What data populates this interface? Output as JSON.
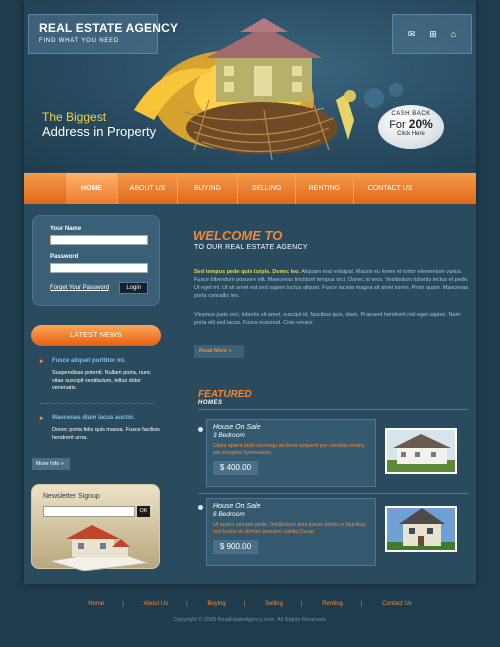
{
  "header": {
    "title": "REAL ESTATE AGENCY",
    "tagline": "FIND WHAT YOU NEED",
    "slogan_line1": "The Biggest",
    "slogan_line2": "Address in Property",
    "cashback": {
      "line1": "CASH BACK",
      "for_label": "For",
      "percent": "20%",
      "cta": "Click Here"
    },
    "icons": [
      "mail-icon",
      "sitemap-icon",
      "home-icon"
    ]
  },
  "nav": {
    "items": [
      {
        "label": "HOME",
        "active": true
      },
      {
        "label": "ABOUT US",
        "active": false
      },
      {
        "label": "BUYING",
        "active": false
      },
      {
        "label": "SELLING",
        "active": false
      },
      {
        "label": "RENTING",
        "active": false
      },
      {
        "label": "CONTACT US",
        "active": false
      }
    ]
  },
  "login": {
    "name_label": "Your Name",
    "password_label": "Password",
    "forgot_label": "Forget Your Password",
    "login_button": "Login"
  },
  "news": {
    "heading": "LATEST NEWS",
    "items": [
      {
        "title": "Fusce aliquet porttitor mi.",
        "body": "Suspendisse potenti. Nullam porta, nunc vitae suscipit vestibulum, tellus dolor venenatis."
      },
      {
        "title": "Maecenas diam lacus auctor.",
        "body": "Donec porta felis quis massa. Fusce facilisis hendrerit urna."
      }
    ],
    "more_label": "More Info"
  },
  "newsletter": {
    "title": "Newsletter Signup",
    "ok_label": "OK"
  },
  "welcome": {
    "title": "WELCOME TO",
    "subtitle": "TO OUR REAL ESTATE AGENCY",
    "lead": "Sed tempus pede quis turpis. Donec leo.",
    "para1": " Aliquam erat volutpat. Mauris eu lorem et tortor elementum varius. Fusce bibendum posuere elit. Maecenas tincidunt tempus orci. Donec id eros. Vestibulum lobortis lectus et pede. Ut eget mi. Ut sit amet est sed sapien luctus aliquet. Fusce lacinia magna sit amet lorem. Proin quam. Maecenas porta convallis leo.",
    "para2": "Vivamus justo orci, lobortis sit amet, suscipit id, faucibus quis, diam. Praesent hendrerit nisl eget sapien. Nam porta elit sed lacus. Fusce euismod. Cras ornare.",
    "read_more": "Read More"
  },
  "featured": {
    "title": "FEATURED",
    "subtitle": "HOMES",
    "homes": [
      {
        "title": "House On Sale",
        "bedrooms": "3 Bedroom",
        "desc": "Class aptent taciti sociosqu ad litora torquent per conubia nostra, per inceptos hymenaeos.",
        "price": "$ 400.00"
      },
      {
        "title": "House On Sale",
        "bedrooms": "6 Bedroom",
        "desc": "Ut auctor semper pede. Vestibulum ante ipsum primis in faucibus orci luctus et ultrices posuere cubilia Curae.",
        "price": "$ 900.00"
      }
    ]
  },
  "footer": {
    "links": [
      "Home",
      "About Us",
      "Buying",
      "Selling",
      "Renting",
      "Contact Us"
    ],
    "copyright": "Copyright © 2008 RealEstateAgency.com. All Rights Reserved."
  },
  "colors": {
    "accent": "#e8732a",
    "background": "#1f3c4e",
    "panel": "#2a4a5e",
    "highlight": "#f2d24b"
  }
}
